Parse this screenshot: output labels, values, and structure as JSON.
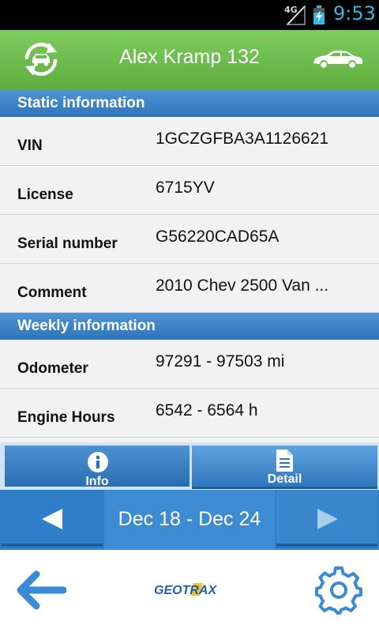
{
  "status_bar": {
    "network": "4G",
    "time": "9:53"
  },
  "app_bar": {
    "title": "Alex Kramp 132"
  },
  "static_section": {
    "title": "Static information",
    "rows": [
      {
        "label": "VIN",
        "value": "1GCZGFBA3A1126621"
      },
      {
        "label": "License",
        "value": "6715YV"
      },
      {
        "label": "Serial number",
        "value": "G56220CAD65A"
      },
      {
        "label": "Comment",
        "value": "2010 Chev 2500 Van ..."
      }
    ]
  },
  "weekly_section": {
    "title": "Weekly information",
    "rows": [
      {
        "label": "Odometer",
        "value": "97291 - 97503 mi"
      },
      {
        "label": "Engine Hours",
        "value": "6542 - 6564 h"
      }
    ]
  },
  "tabs": [
    {
      "label": "Info",
      "icon": "info-icon",
      "active": true
    },
    {
      "label": "Detail",
      "icon": "document-icon",
      "active": false
    }
  ],
  "date_nav": {
    "range": "Dec 18 - Dec 24"
  },
  "footer": {
    "logo_text": "GEOTRAX"
  },
  "colors": {
    "app_bar": "#6cbd4c",
    "section_header": "#3d85c6",
    "status_time": "#33b5e5",
    "date_bar": "#2f7fc8"
  }
}
